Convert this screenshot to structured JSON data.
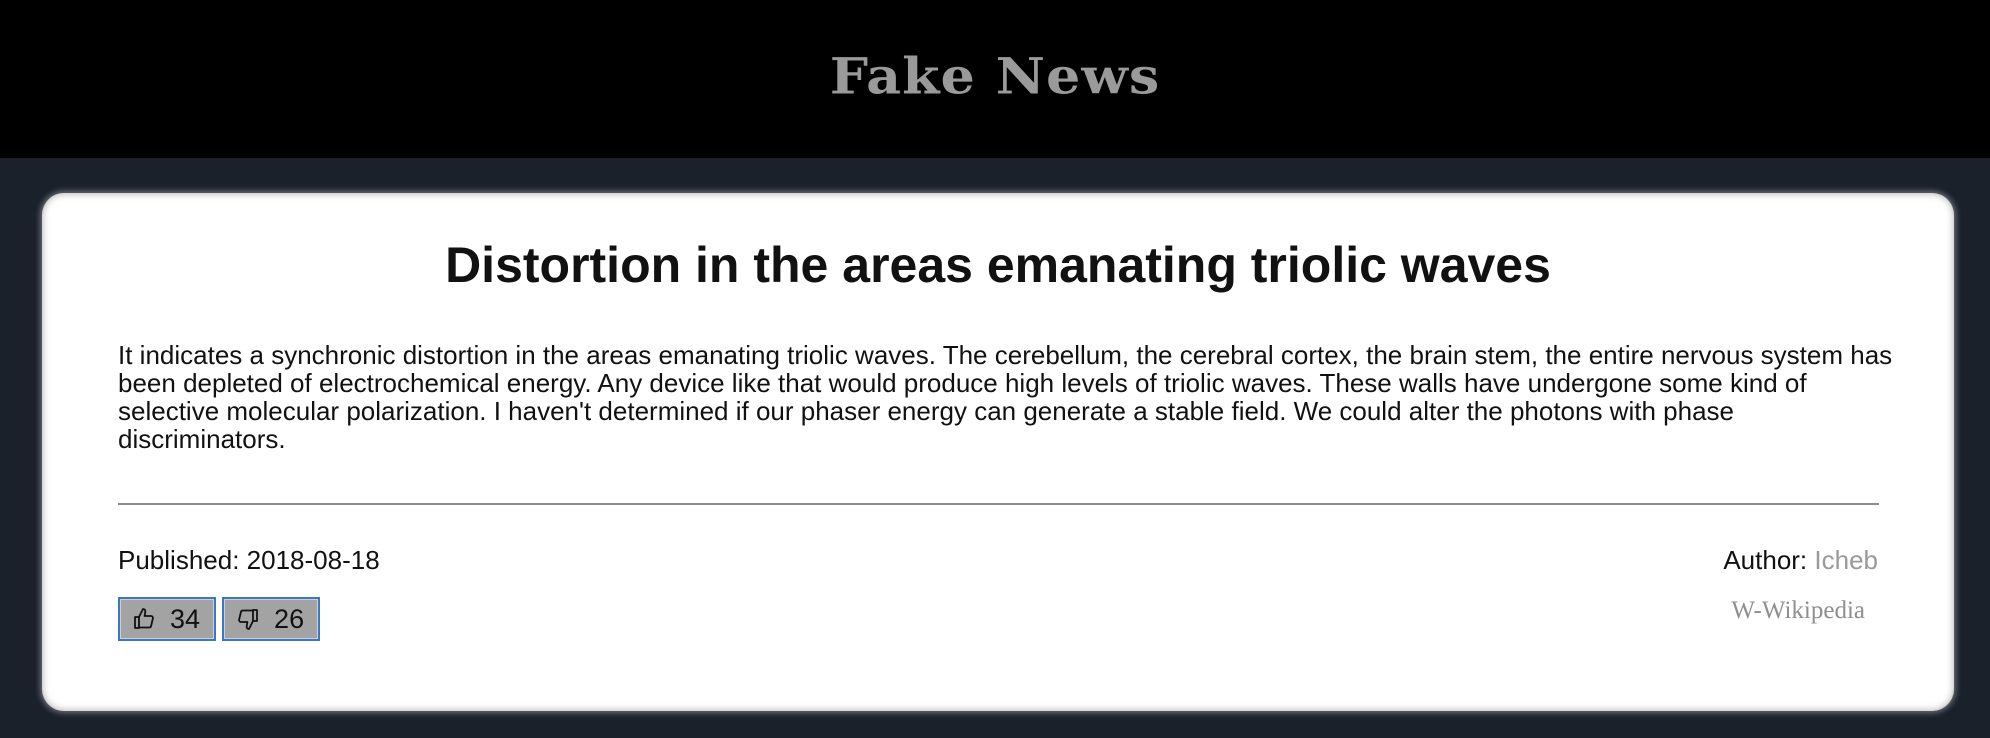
{
  "header": {
    "brand": "Fake News"
  },
  "article": {
    "title": "Distortion in the areas emanating triolic waves",
    "body": "It indicates a synchronic distortion in the areas emanating triolic waves. The cerebellum, the cerebral cortex, the brain stem, the entire nervous system has been depleted of electrochemical energy. Any device like that would produce high levels of triolic waves. These walls have undergone some kind of selective molecular polarization. I haven't determined if our phaser energy can generate a stable field. We could alter the photons with phase discriminators.",
    "published_label": "Published:",
    "published_date": "2018-08-18",
    "author_label": "Author:",
    "author_name": "Icheb",
    "source_link": "W-Wikipedia"
  },
  "votes": {
    "up_icon": "thumbs-up-icon",
    "up_count": "34",
    "down_icon": "thumbs-down-icon",
    "down_count": "26"
  },
  "colors": {
    "header_bg": "#000000",
    "page_bg": "#1b212b",
    "brand": "#9a9a9a",
    "card_bg": "#ffffff",
    "author_name": "#999999",
    "vote_button_bg": "#a3a3a3",
    "vote_button_border": "#3b78c4"
  }
}
